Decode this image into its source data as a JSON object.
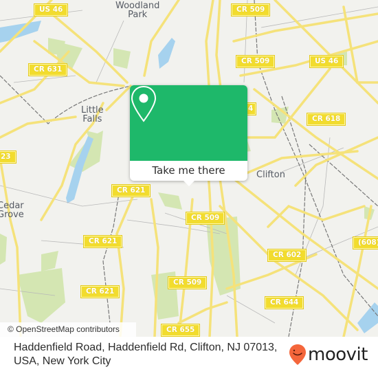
{
  "map": {
    "place_labels": [
      {
        "id": "woodland-park",
        "text": "Woodland\nPark"
      },
      {
        "id": "little-falls",
        "text": "Little\nFalls"
      },
      {
        "id": "cedar-grove",
        "text": "Cedar\nGrove"
      },
      {
        "id": "clifton",
        "text": "Clifton"
      }
    ],
    "road_shields": [
      {
        "id": "us-46-west",
        "text": "US 46"
      },
      {
        "id": "cr-509-north",
        "text": "CR 509"
      },
      {
        "id": "cr-631",
        "text": "CR 631"
      },
      {
        "id": "cr-509-mid",
        "text": "CR 509"
      },
      {
        "id": "us-46-east",
        "text": "US 46"
      },
      {
        "id": "cr-618",
        "text": "CR 618"
      },
      {
        "id": "cr-623-partial",
        "text": "23"
      },
      {
        "id": "cr-621-a",
        "text": "CR 621"
      },
      {
        "id": "cr-509-south",
        "text": "CR 509"
      },
      {
        "id": "cr-621-b",
        "text": "CR 621"
      },
      {
        "id": "cr-602",
        "text": "CR 602"
      },
      {
        "id": "route-608",
        "text": "(608)"
      },
      {
        "id": "cr-509-lower",
        "text": "CR 509"
      },
      {
        "id": "cr-621-c",
        "text": "CR 621"
      },
      {
        "id": "cr-644",
        "text": "CR 644"
      },
      {
        "id": "cr-655",
        "text": "CR 655"
      },
      {
        "id": "partial-4",
        "text": "4"
      }
    ],
    "attribution": "© OpenStreetMap contributors"
  },
  "popup": {
    "icon": "map-pin-icon",
    "button_label": "Take me there",
    "accent_color": "#1eb86a"
  },
  "footer": {
    "address": "Haddenfield Road, Haddenfield Rd, Clifton, NJ 07013, USA, New York City",
    "logo_text": "moovit",
    "logo_color": "#f4663b"
  }
}
